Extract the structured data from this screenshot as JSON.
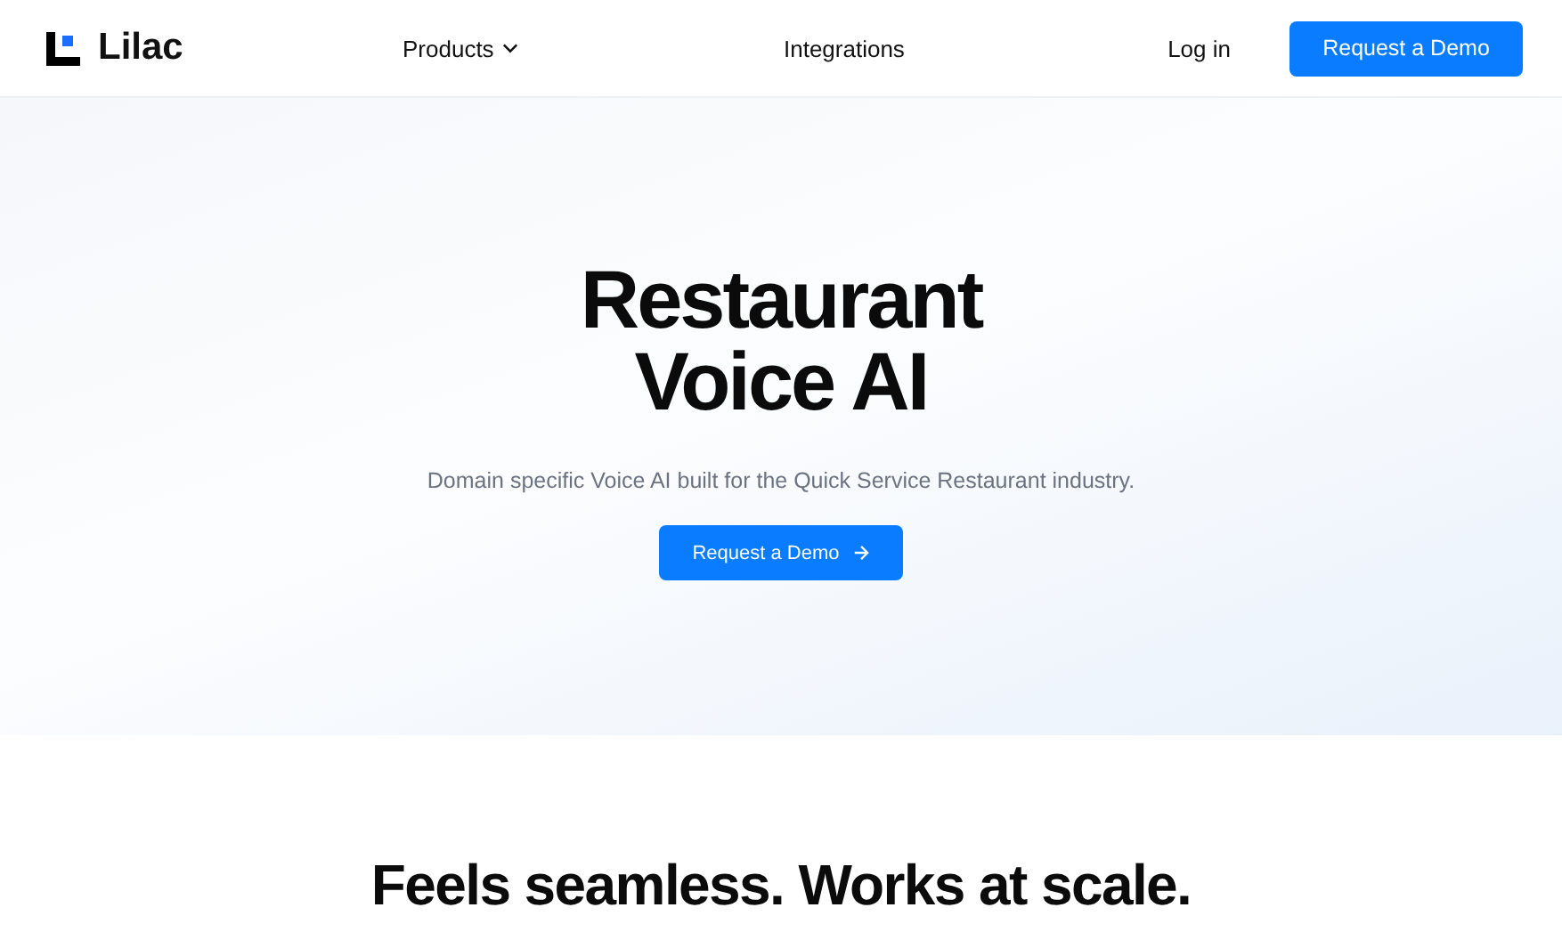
{
  "header": {
    "logo": "Lilac",
    "nav": [
      {
        "label": "Products",
        "dropdown": true
      },
      {
        "label": "Integrations",
        "dropdown": false
      }
    ],
    "login": "Log in",
    "cta": "Request a Demo"
  },
  "hero": {
    "title_lines": [
      "Restaurant",
      "Voice AI"
    ],
    "subtitle": "Domain specific Voice AI built for the Quick Service Restaurant industry.",
    "cta": "Request a Demo"
  },
  "section": {
    "heading": "Feels seamless. Works at scale."
  }
}
